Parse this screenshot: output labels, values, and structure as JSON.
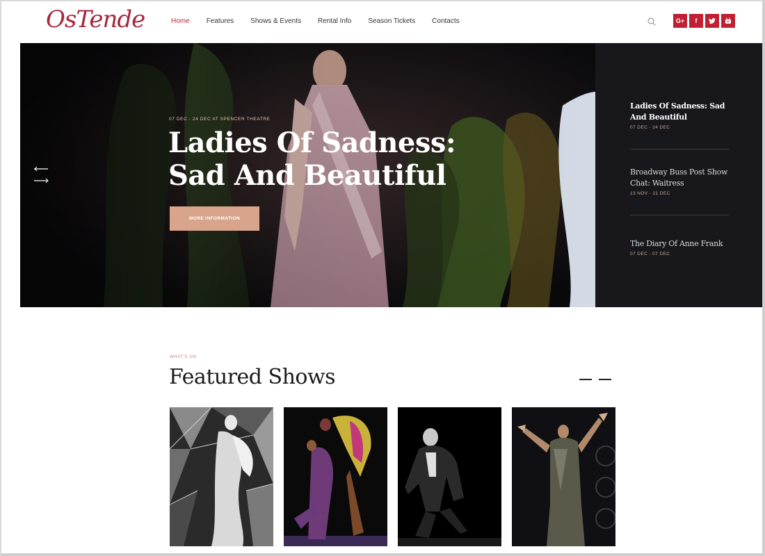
{
  "header": {
    "logo": "OsTende",
    "nav": [
      {
        "label": "Home",
        "active": true
      },
      {
        "label": "Features"
      },
      {
        "label": "Shows & Events"
      },
      {
        "label": "Rental Info"
      },
      {
        "label": "Season Tickets"
      },
      {
        "label": "Contacts"
      }
    ],
    "search_icon": "search-icon",
    "social": [
      {
        "name": "google-plus-icon",
        "glyph": "G+"
      },
      {
        "name": "facebook-icon",
        "glyph": "f"
      },
      {
        "name": "twitter-icon",
        "glyph": "t"
      },
      {
        "name": "youtube-icon",
        "glyph": "▶"
      }
    ],
    "accent_color": "#c11f32"
  },
  "hero": {
    "date_venue": "07 DEC - 24 DEC AT SPENCER THEATRE",
    "title": "Ladies Of Sadness: Sad And Beautiful",
    "button_label": "MORE INFORMATION",
    "button_color": "#d8a58c"
  },
  "sidebar": {
    "items": [
      {
        "title": "Ladies Of Sadness: Sad And Beautiful",
        "date": "07 DEC - 24 DEC",
        "active": true
      },
      {
        "title": "Broadway Buss Post Show Chat: Waitress",
        "date": "13 NOV - 21 DEC"
      },
      {
        "title": "The Diary Of Anne Frank",
        "date": "07 DEC - 07 DEC"
      }
    ]
  },
  "featured": {
    "eyebrow": "WHAT'S ON",
    "title": "Featured Shows",
    "cards": [
      {
        "name": "show-card-1"
      },
      {
        "name": "show-card-2"
      },
      {
        "name": "show-card-3"
      },
      {
        "name": "show-card-4"
      }
    ]
  }
}
